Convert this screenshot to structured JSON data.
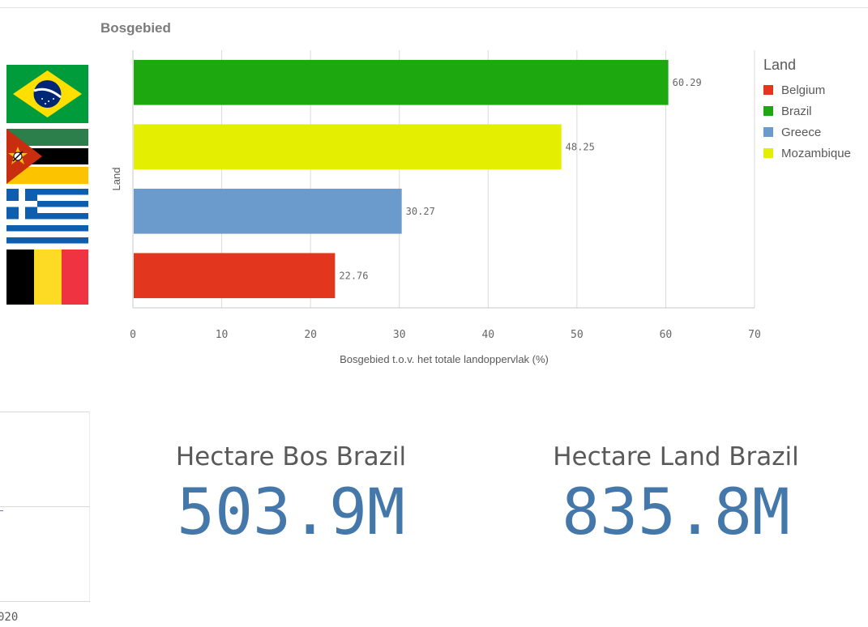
{
  "chart_data": {
    "type": "bar",
    "orientation": "horizontal",
    "title": "Bosgebied",
    "categories": [
      "Brazil",
      "Mozambique",
      "Greece",
      "Belgium"
    ],
    "values": [
      60.29,
      48.25,
      30.27,
      22.76
    ],
    "value_labels": [
      "60.29",
      "48.25",
      "30.27",
      "22.76"
    ],
    "bar_colors": [
      "#1ea80f",
      "#e4ee00",
      "#6b9bcd",
      "#e3361f"
    ],
    "xlabel": "Bosgebied t.o.v. het totale landoppervlak (%)",
    "ylabel": "Land",
    "xlim": [
      0,
      70
    ],
    "xticks": [
      "0",
      "10",
      "20",
      "30",
      "40",
      "50",
      "60",
      "70"
    ],
    "grid": true,
    "legend": {
      "title": "Land",
      "placement": "right",
      "items": [
        {
          "label": "Belgium",
          "color": "#e3361f"
        },
        {
          "label": "Brazil",
          "color": "#1ea80f"
        },
        {
          "label": "Greece",
          "color": "#6b9bcd"
        },
        {
          "label": "Mozambique",
          "color": "#e4ee00"
        }
      ]
    }
  },
  "flags": [
    "brazil-flag-icon",
    "mozambique-flag-icon",
    "greece-flag-icon",
    "belgium-flag-icon"
  ],
  "left_panel": {
    "year_fragment": "020"
  },
  "kpis": [
    {
      "label": "Hectare Bos Brazil",
      "value": "503.9M"
    },
    {
      "label": "Hectare Land Brazil",
      "value": "835.8M"
    }
  ]
}
